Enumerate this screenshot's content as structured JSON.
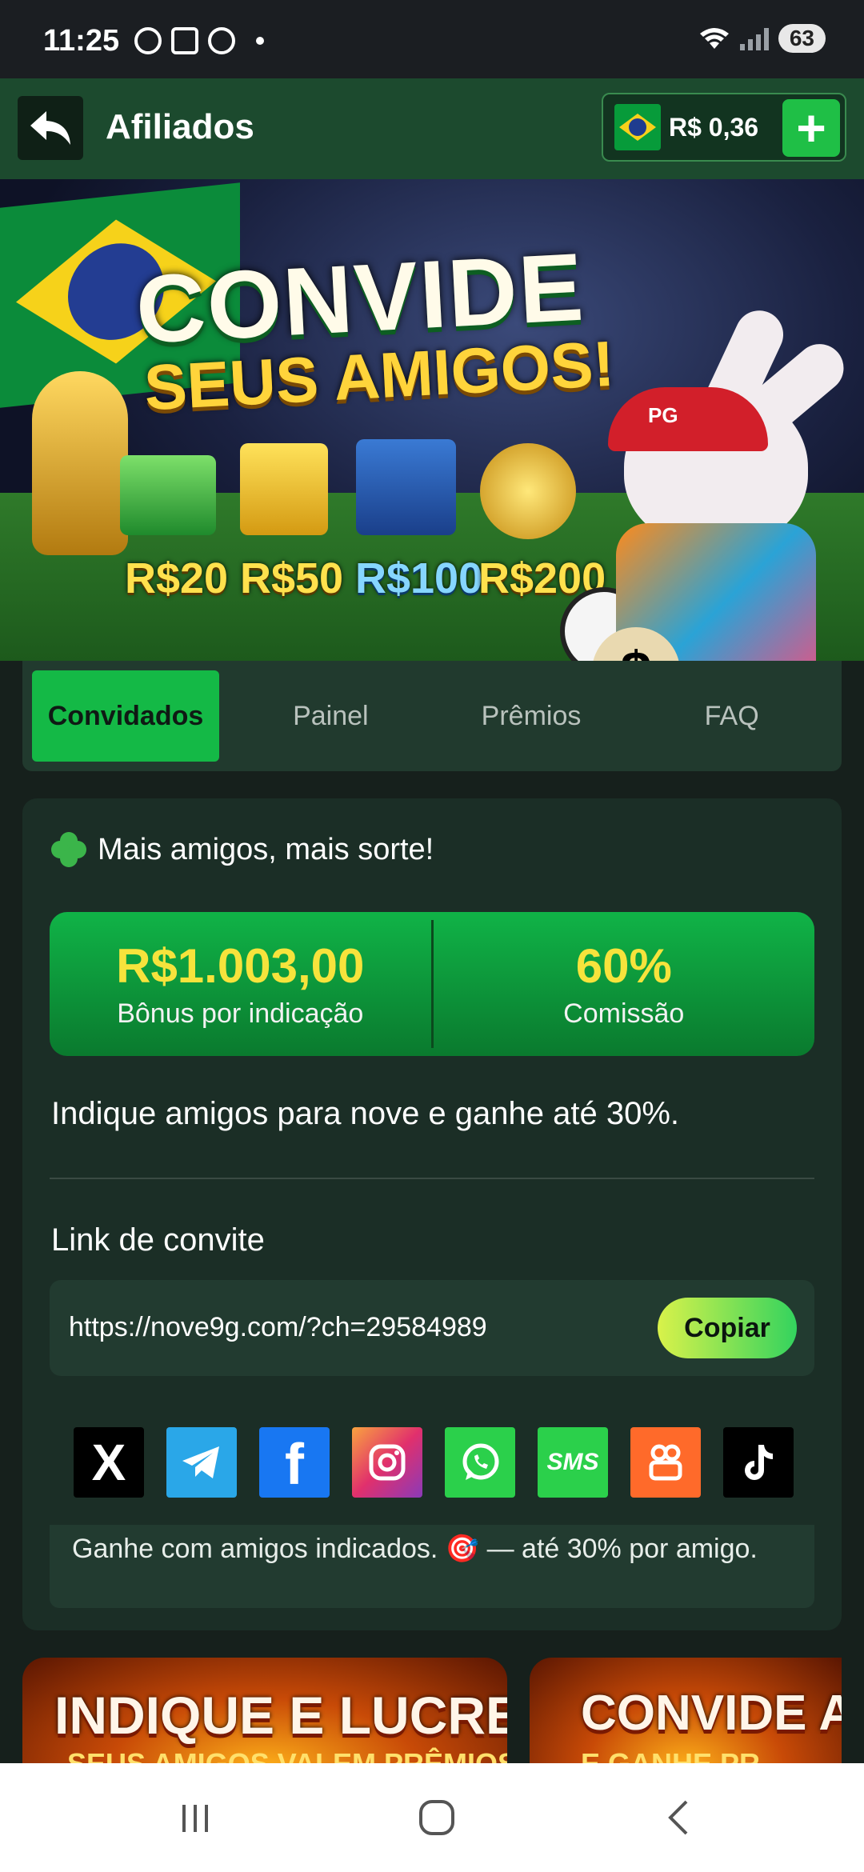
{
  "status_bar": {
    "time": "11:25",
    "battery": "63"
  },
  "header": {
    "title": "Afiliados",
    "balance": "R$ 0,36",
    "back_icon": "back-arrow-icon",
    "add_icon": "plus-icon"
  },
  "banner": {
    "title": "CONVIDE",
    "subtitle": "SEUS AMIGOS!",
    "prizes": [
      "R$20",
      "R$50",
      "R$100",
      "R$200"
    ],
    "mascot_cap": "PG"
  },
  "tabs": [
    {
      "label": "Convidados",
      "active": true
    },
    {
      "label": "Painel",
      "active": false
    },
    {
      "label": "Prêmios",
      "active": false
    },
    {
      "label": "FAQ",
      "active": false
    }
  ],
  "card": {
    "heading": "Mais amigos, mais sorte!",
    "stats": [
      {
        "value": "R$1.003,00",
        "label": "Bônus por indicação"
      },
      {
        "value": "60%",
        "label": "Comissão"
      }
    ],
    "invite_text": "Indique amigos para nove e ganhe até 30%.",
    "link_label": "Link de convite",
    "link_url": "https://nove9g.com/?ch=29584989",
    "copy_label": "Copiar",
    "share_labels": {
      "sms": "SMS",
      "facebook": "f",
      "x": "X"
    },
    "promo_note": "Ganhe com amigos indicados. 🎯 — até 30% por amigo."
  },
  "promo_cards": [
    {
      "title": "INDIQUE E LUCRE",
      "subtitle": "SEUS AMIGOS VALEM PRÊMIOS"
    },
    {
      "title": "CONVIDE AM",
      "subtitle": "E GANHE PR"
    }
  ],
  "colors": {
    "accent_green": "#14b946",
    "header_bg": "#1c4a2e",
    "card_bg": "#1b2e26",
    "stat_value": "#f6e33c"
  }
}
